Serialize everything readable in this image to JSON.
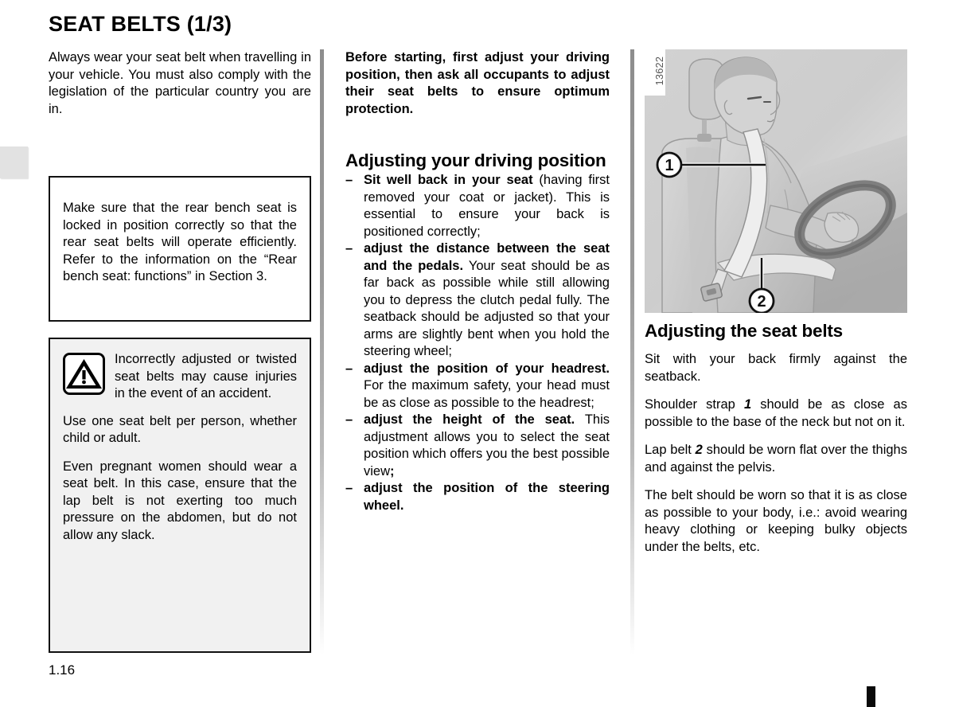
{
  "page": {
    "title": "SEAT BELTS (1/3)",
    "number": "1.16"
  },
  "left_column": {
    "intro": "Always wear your seat belt when travelling in your vehicle. You must also comply with the legislation of the particular country you are in.",
    "rear_bench_box": {
      "text": "Make sure that the rear bench seat is locked in position correctly so that the rear seat belts will operate efficiently. Refer to the information on the “Rear bench seat: functions” in Section 3."
    },
    "warning_box": {
      "icon": "warning-triangle-icon",
      "warning_text": "Incorrectly adjusted or twisted seat belts may cause injuries in the event of an accident.",
      "paragraph_2": "Use one seat belt per person, whether child or adult.",
      "paragraph_3": "Even pregnant women should wear a seat belt. In this case, ensure that the lap belt is not exerting too much pressure on the abdomen, but do not allow any slack."
    }
  },
  "middle_column": {
    "lead": "Before starting, first adjust your driving position, then ask all occupants to adjust their seat belts to ensure optimum protection.",
    "heading": "Adjusting your driving position",
    "bullets": [
      {
        "dash": "–",
        "bold": "Sit well back in your seat",
        "rest": " (having first removed your coat or jacket). This is essential to ensure your back is positioned correctly;"
      },
      {
        "dash": "–",
        "bold": "adjust the distance between the seat and the pedals.",
        "rest": " Your seat should be as far back as possible while still allowing you to depress the clutch pedal fully. The seatback should be adjusted so that your arms are slightly bent when you hold the steering wheel;"
      },
      {
        "dash": "–",
        "bold": "adjust the position of your headrest.",
        "rest": " For the maximum safety, your head must be as close as possible to the headrest;"
      },
      {
        "dash": "–",
        "bold": "adjust the height of the seat.",
        "rest": " This adjustment allows you to select the seat position which offers you the best possible view",
        "trailing_bold": ";"
      },
      {
        "dash": "–",
        "bold": "adjust the position of the steering wheel.",
        "rest": ""
      }
    ]
  },
  "right_column": {
    "figure": {
      "number": "13622",
      "description": "Driver seated in car seat wearing a three-point seat belt, hands on steering wheel",
      "callouts": [
        {
          "label": "1",
          "refers_to": "shoulder-strap"
        },
        {
          "label": "2",
          "refers_to": "lap-belt"
        }
      ]
    },
    "heading": "Adjusting the seat belts",
    "paragraph_1": "Sit with your back firmly against the seatback.",
    "paragraph_2": {
      "before": "Shoulder strap ",
      "ref": "1",
      "after": " should be as close as possible to the base of the neck but not on it."
    },
    "paragraph_3": {
      "before": "Lap belt ",
      "ref": "2",
      "after": " should be worn flat over the thighs and against the pelvis."
    },
    "paragraph_4": "The belt should be worn so that it is as close as possible to your body, i.e.: avoid wearing heavy clothing or keeping bulky objects under the belts, etc."
  },
  "colors": {
    "text": "#000000",
    "box_border": "#111111",
    "warning_box_fill": "#f1f1f1",
    "divider": "#8d8d8d",
    "edge_tab": "#e2e2e2"
  }
}
